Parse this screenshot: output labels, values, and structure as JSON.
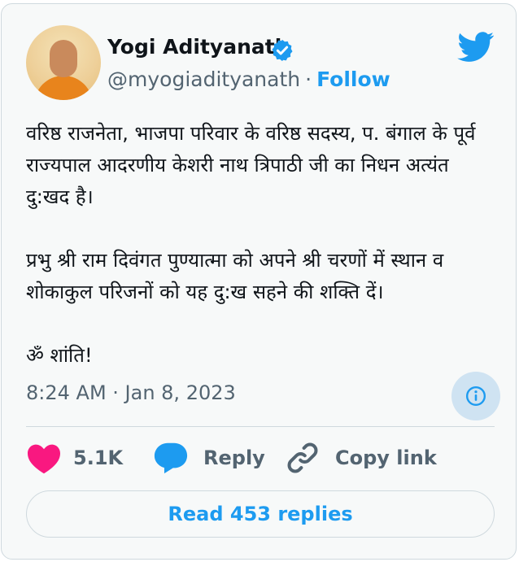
{
  "author": {
    "name": "Yogi Adityanath",
    "handle": "@myogiadityanath",
    "separator": "·",
    "follow_label": "Follow",
    "verified": true
  },
  "tweet": {
    "paragraphs": [
      "वरिष्ठ राजनेता, भाजपा परिवार के वरिष्ठ सदस्य, प. बंगाल के पूर्व राज्यपाल आदरणीय केशरी नाथ त्रिपाठी जी का निधन अत्यंत दु:खद है।",
      "प्रभु श्री राम दिवंगत पुण्यात्मा को अपने श्री चरणों में स्थान व शोकाकुल परिजनों को यह दु:ख सहने की शक्ति दें।",
      "ॐ शांति!"
    ],
    "timestamp": "8:24 AM · Jan 8, 2023"
  },
  "actions": {
    "likes_count": "5.1K",
    "reply_label": "Reply",
    "copy_link_label": "Copy link",
    "read_replies_label": "Read 453 replies"
  },
  "icons": {
    "brand": "twitter-bird-icon",
    "verified": "verified-badge-icon",
    "info": "info-icon",
    "like": "heart-icon",
    "reply": "speech-bubble-icon",
    "copy": "link-icon"
  },
  "colors": {
    "brand_blue": "#1d9bf0",
    "like_pink": "#f91880",
    "muted_text": "#536471",
    "card_background": "#f7f9f9",
    "border": "#cfd9de"
  }
}
